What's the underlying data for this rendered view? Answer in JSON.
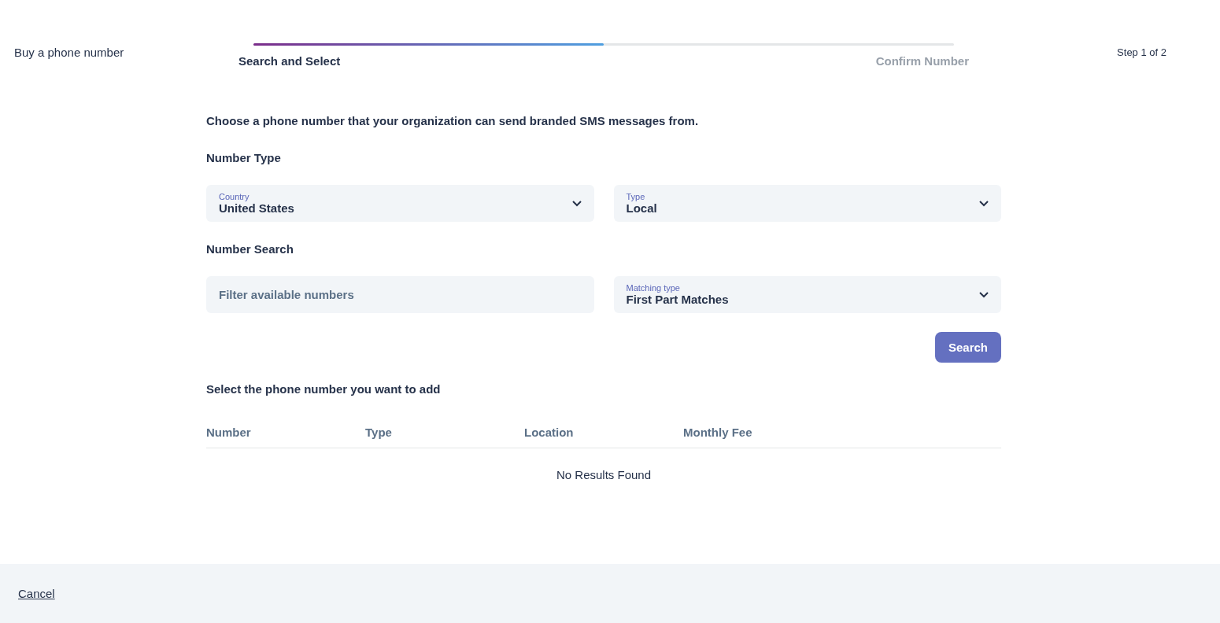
{
  "header": {
    "title": "Buy a phone number",
    "progress": {
      "level": 0.5
    },
    "steps": [
      {
        "label": "Search and Select",
        "selected": true
      },
      {
        "label": "Confirm Number",
        "selected": false
      }
    ],
    "step_counter": "Step 1 of 2"
  },
  "intro": "Choose a phone number that your organization can send branded SMS messages from.",
  "number_type": {
    "heading": "Number Type",
    "fields": [
      {
        "kind": "select",
        "label": "Country",
        "value": "United States"
      },
      {
        "kind": "select",
        "label": "Type",
        "value": "Local"
      }
    ]
  },
  "number_search": {
    "heading": "Number Search",
    "fields": [
      {
        "kind": "input",
        "placeholder": "Filter available numbers"
      },
      {
        "kind": "select",
        "label": "Matching type",
        "value": "First Part Matches"
      }
    ],
    "button": "Search"
  },
  "results": {
    "heading": "Select the phone number you want to add",
    "columns": [
      "Number",
      "Type",
      "Location",
      "Monthly Fee"
    ],
    "empty": "No Results Found"
  },
  "footer": {
    "cancel": "Cancel"
  }
}
